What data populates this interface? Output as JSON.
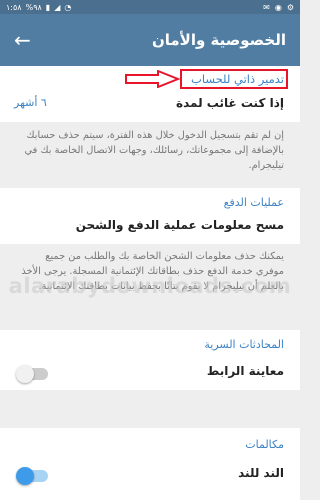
{
  "status_bar": {
    "time": "١:٥٨",
    "battery": "%٩٨"
  },
  "app_bar": {
    "title": "الخصوصية والأمان"
  },
  "self_destruct": {
    "link_label": "تدمير ذاتي للحساب",
    "row_label": "إذا كنت غائب لمدة",
    "row_value": "٦ أشهر",
    "info": "إن لم تقم بتسجيل الدخول خلال هذه الفترة، سيتم حذف حسابك بالإضافة إلى مجموعاتك، رسائلك، وجهات الاتصال الخاصة بك في تيليجرام."
  },
  "payments": {
    "header": "عمليات الدفع",
    "row_label": "مسح معلومات عملية الدفع والشحن",
    "info": "يمكنك حذف معلومات الشحن الخاصة بك والطلب من جميع موفري خدمة الدفع حذف بطاقاتك الإئتمانية المسجلة. يرجى الأخذ بالعلم أن تيليجرام لا يقوم بتاتًا بحفظ بيانات بطاقتك الإئتمانية."
  },
  "secret_chats": {
    "header": "المحادثات السرية",
    "row_label": "معاينة الرابط",
    "toggle_on": false
  },
  "calls": {
    "header": "مكالمات",
    "row_label": "الند للند",
    "toggle_on": true
  },
  "watermark": "alarabydownloads.com",
  "colors": {
    "app_bar": "#517da2",
    "accent": "#3d82c4",
    "annotation": "#e8152a"
  }
}
